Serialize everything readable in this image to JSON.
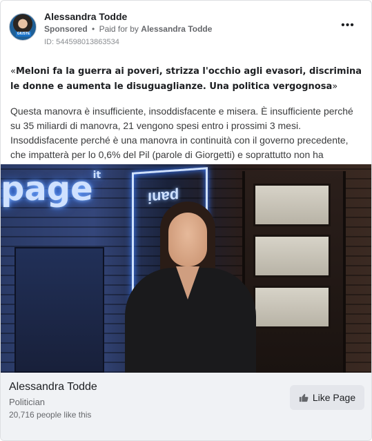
{
  "ad": {
    "page_name": "Alessandra Todde",
    "sponsored_label": "Sponsored",
    "separator": "•",
    "paid_for_prefix": "Paid for by",
    "paid_for_name": "Alessandra Todde",
    "ad_id": "ID: 544598013863534",
    "more_options": "•••",
    "avatar_badge": "GIUSTE"
  },
  "post": {
    "headline_open": "«",
    "headline_bold": "Meloni fa la guerra ai poveri, strizza l'occhio agli evasori, discrimina le donne e aumenta le disuguaglianze. Una politica vergognosa",
    "headline_close": "»",
    "body": "Questa manovra è insufficiente, insoddisfacente e misera. È insufficiente perché su 35 miliardi di manovra, 21 vengono spesi entro i prossimi 3 mesi. Insoddisfacente perché è una manovra in continuità con il governo precedente, che impatterà per lo 0,6% del Pil (parole di Giorgetti) e soprattutto non ha nessun…"
  },
  "media": {
    "neon_text": "page",
    "neon_suffix": "it",
    "neon_box_text": "ᴉuɐd"
  },
  "footer": {
    "name": "Alessandra Todde",
    "category": "Politician",
    "likes": "20,716 people like this",
    "like_button": "Like Page"
  },
  "colors": {
    "footer_bg": "#f0f2f5",
    "button_bg": "#e4e6eb",
    "meta_text": "#65676b"
  }
}
